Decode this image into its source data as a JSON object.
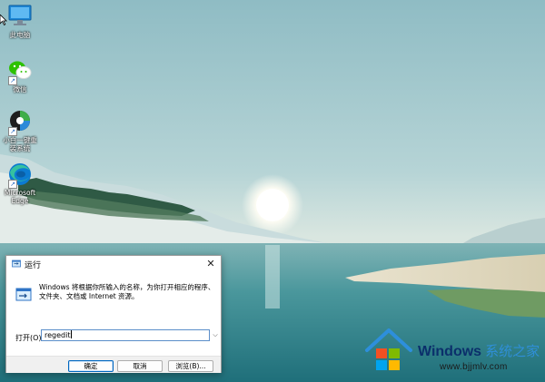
{
  "desktop": {
    "icons": [
      {
        "label": "此电脑",
        "icon": "monitor-icon"
      },
      {
        "label": "微信",
        "icon": "wechat-icon"
      },
      {
        "label": "小白一键重装系统",
        "icon": "xiaobai-icon"
      },
      {
        "label": "Microsoft Edge",
        "icon": "edge-icon"
      }
    ]
  },
  "run_dialog": {
    "title": "运行",
    "description": "Windows 将根据你所输入的名称，为你打开相应的程序、文件夹、文档或 Internet 资源。",
    "open_label": "打开(O):",
    "input_value": "regedit",
    "buttons": {
      "ok": "确定",
      "cancel": "取消",
      "browse": "浏览(B)..."
    }
  },
  "watermark": {
    "brand": "Windows",
    "brand_cn": "系统之家",
    "url": "www.bjjmlv.com"
  },
  "colors": {
    "accent": "#0067c0",
    "input_border": "#5b8ec9",
    "sky": "#a9cdd3",
    "water": "#3f8b94"
  }
}
